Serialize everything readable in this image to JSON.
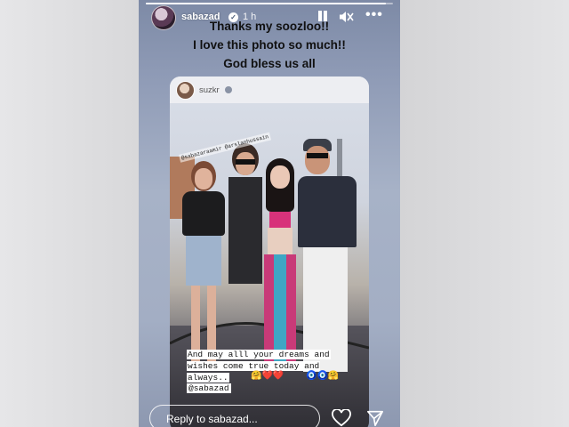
{
  "story": {
    "progress_fraction": 0.97,
    "username": "sabazad",
    "time": "1 h",
    "caption_lines": [
      "Thanks my soozloo!!",
      "I love this photo so much!!",
      "God bless us all"
    ]
  },
  "reshared_post": {
    "username": "suzkr",
    "photo_tag": "@sabazaraamir @arslanhussain",
    "overlay_lines": [
      "And may alll your dreams and",
      "wishes come true today and",
      "always.."
    ],
    "mention": "@sabazad"
  },
  "reply_bar": {
    "placeholder": "Reply to sabazad..."
  },
  "icons": {
    "header": [
      "pause-icon",
      "mute-icon",
      "more-icon"
    ],
    "footer": [
      "heart-icon",
      "send-icon"
    ]
  },
  "colors": {
    "story_background": "#8f9bb6",
    "caption_text": "#111111",
    "ui_text": "#ffffff"
  }
}
